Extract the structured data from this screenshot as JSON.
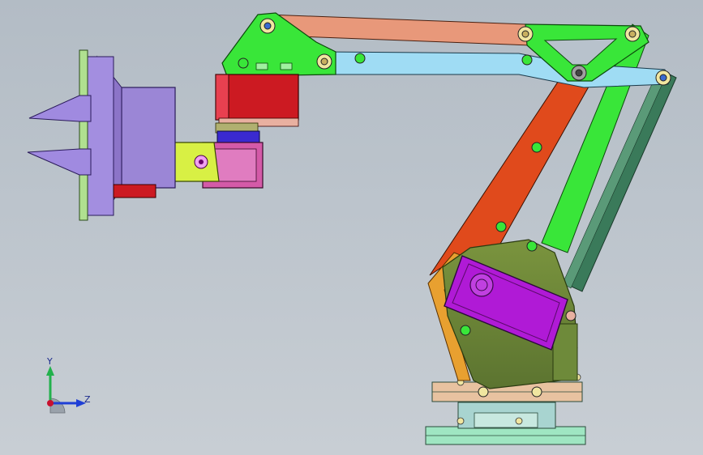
{
  "viewport": {
    "background_top": "#b3bcc5",
    "background_bottom": "#c8ced4"
  },
  "triad": {
    "y_label": "Y",
    "z_label": "Z",
    "y_color": "#22b14c",
    "z_color": "#1f3fd6",
    "origin_color": "#c8102e"
  },
  "colors": {
    "upper_link": "#e8987a",
    "light_link": "#9fdcf4",
    "green_link": "#39e639",
    "orange_link": "#e04a1c",
    "teal_link": "#3a7a5a",
    "base_plate": "#6e8a3a",
    "purple_motor": "#b01ad6",
    "red_motor": "#cc1a22",
    "gripper": "#9b86d6",
    "pink_joint": "#d45aa8",
    "yellow_bracket": "#d8f044"
  }
}
